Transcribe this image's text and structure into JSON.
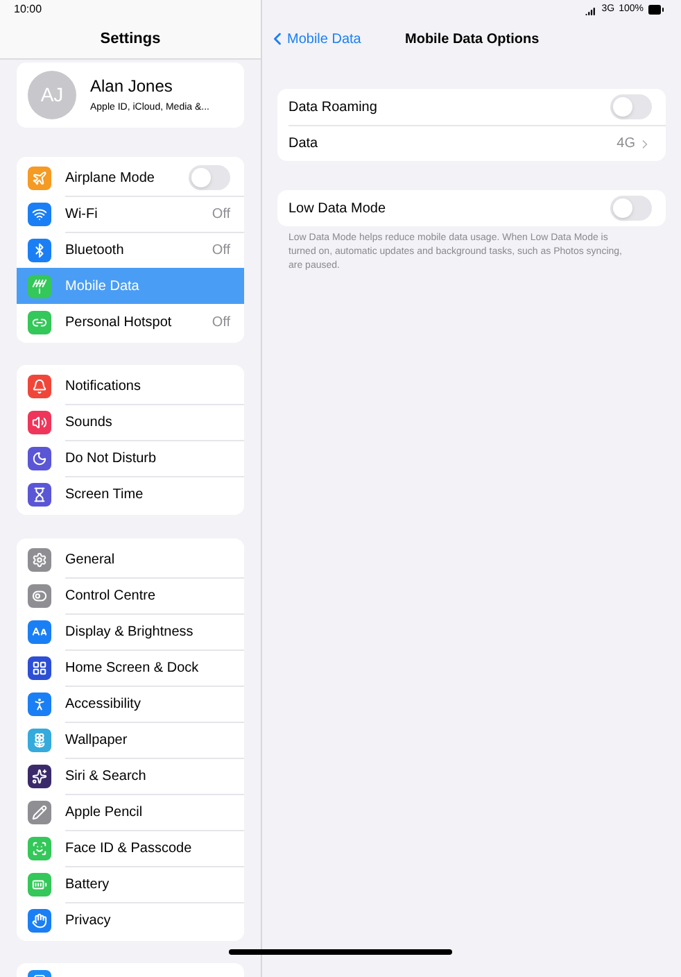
{
  "status_bar": {
    "time": "10:00",
    "network": "3G",
    "battery": "100%"
  },
  "sidebar": {
    "title": "Settings",
    "profile": {
      "initials": "AJ",
      "name": "Alan Jones",
      "subtitle": "Apple ID, iCloud, Media &..."
    },
    "groups": [
      {
        "items": [
          {
            "label": "Airplane Mode",
            "kind": "toggle",
            "on": false,
            "selected": false
          },
          {
            "label": "Wi-Fi",
            "kind": "value",
            "value": "Off",
            "selected": false
          },
          {
            "label": "Bluetooth",
            "kind": "value",
            "value": "Off",
            "selected": false
          },
          {
            "label": "Mobile Data",
            "kind": "plain",
            "selected": true
          },
          {
            "label": "Personal Hotspot",
            "kind": "value",
            "value": "Off",
            "selected": false
          }
        ]
      },
      {
        "items": [
          {
            "label": "Notifications",
            "kind": "plain",
            "selected": false
          },
          {
            "label": "Sounds",
            "kind": "plain",
            "selected": false
          },
          {
            "label": "Do Not Disturb",
            "kind": "plain",
            "selected": false
          },
          {
            "label": "Screen Time",
            "kind": "plain",
            "selected": false
          }
        ]
      },
      {
        "items": [
          {
            "label": "General",
            "kind": "plain",
            "selected": false
          },
          {
            "label": "Control Centre",
            "kind": "plain",
            "selected": false
          },
          {
            "label": "Display & Brightness",
            "kind": "plain",
            "selected": false
          },
          {
            "label": "Home Screen & Dock",
            "kind": "plain",
            "selected": false
          },
          {
            "label": "Accessibility",
            "kind": "plain",
            "selected": false
          },
          {
            "label": "Wallpaper",
            "kind": "plain",
            "selected": false
          },
          {
            "label": "Siri & Search",
            "kind": "plain",
            "selected": false
          },
          {
            "label": "Apple Pencil",
            "kind": "plain",
            "selected": false
          },
          {
            "label": "Face ID & Passcode",
            "kind": "plain",
            "selected": false
          },
          {
            "label": "Battery",
            "kind": "plain",
            "selected": false
          },
          {
            "label": "Privacy",
            "kind": "plain",
            "selected": false
          }
        ]
      }
    ]
  },
  "detail": {
    "back_label": "Mobile Data",
    "title": "Mobile Data Options",
    "sections": [
      {
        "rows": [
          {
            "label": "Data Roaming",
            "kind": "toggle",
            "on": false
          },
          {
            "label": "Data",
            "kind": "value",
            "value": "4G"
          }
        ]
      },
      {
        "rows": [
          {
            "label": "Low Data Mode",
            "kind": "toggle",
            "on": false
          }
        ],
        "footer": "Low Data Mode helps reduce mobile data usage. When Low Data Mode is turned on, automatic updates and background tasks, such as Photos syncing, are paused."
      }
    ]
  }
}
